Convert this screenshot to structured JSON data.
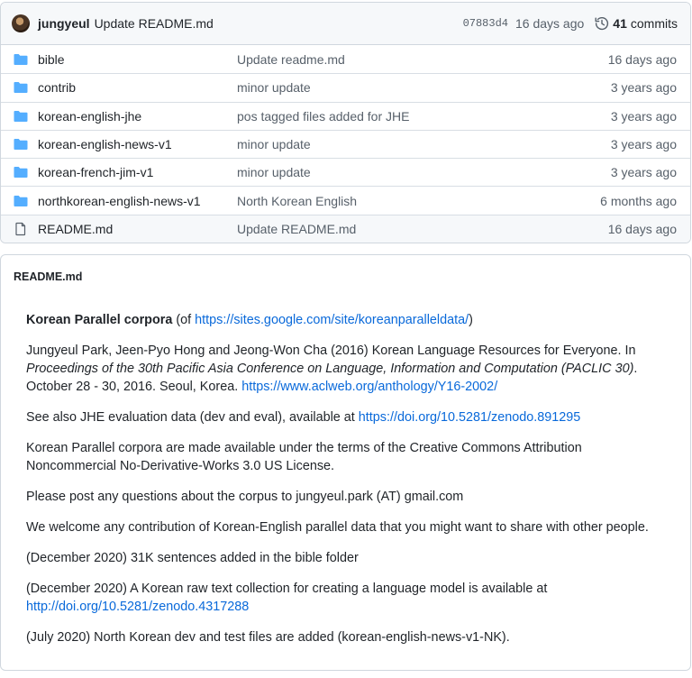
{
  "latest_commit": {
    "author": "jungyeul",
    "message": "Update README.md",
    "sha": "07883d4",
    "age": "16 days ago",
    "commits_count": "41",
    "commits_label": "commits"
  },
  "files": [
    {
      "name": "bible",
      "type": "folder",
      "commit": "Update readme.md",
      "age": "16 days ago"
    },
    {
      "name": "contrib",
      "type": "folder",
      "commit": "minor update",
      "age": "3 years ago"
    },
    {
      "name": "korean-english-jhe",
      "type": "folder",
      "commit": "pos tagged files added for JHE",
      "age": "3 years ago"
    },
    {
      "name": "korean-english-news-v1",
      "type": "folder",
      "commit": "minor update",
      "age": "3 years ago"
    },
    {
      "name": "korean-french-jim-v1",
      "type": "folder",
      "commit": "minor update",
      "age": "3 years ago"
    },
    {
      "name": "northkorean-english-news-v1",
      "type": "folder",
      "commit": "North Korean English",
      "age": "6 months ago"
    },
    {
      "name": "README.md",
      "type": "file",
      "commit": "Update README.md",
      "age": "16 days ago"
    }
  ],
  "readme": {
    "title": "README.md",
    "p1_bold": "Korean Parallel corpora",
    "p1_pre": " (of ",
    "p1_link": "https://sites.google.com/site/koreanparalleldata/",
    "p1_post": ")",
    "p2_text": "Jungyeul Park, Jeen-Pyo Hong and Jeong-Won Cha (2016) Korean Language Resources for Everyone. In ",
    "p2_em": "Proceedings of the 30th Pacific Asia Conference on Language, Information and Computation (PACLIC 30)",
    "p2_text2": ". October 28 - 30, 2016. Seoul, Korea. ",
    "p2_link": "https://www.aclweb.org/anthology/Y16-2002/",
    "p3_text": "See also JHE evaluation data (dev and eval), available at ",
    "p3_link": "https://doi.org/10.5281/zenodo.891295",
    "p4_text": "Korean Parallel corpora are made available under the terms of the Creative Commons Attribution Noncommercial No-Derivative-Works 3.0 US License.",
    "p5_text": "Please post any questions about the corpus to jungyeul.park (AT) gmail.com",
    "p6_text": "We welcome any contribution of Korean-English parallel data that you might want to share with other people.",
    "p7_text": "(December 2020) 31K sentences added in the bible folder",
    "p8_text": "(December 2020) A Korean raw text collection for creating a language model is available at ",
    "p8_link": "http://doi.org/10.5281/zenodo.4317288",
    "p9_text": "(July 2020) North Korean dev and test files are added (korean-english-news-v1-NK)."
  },
  "colors": {
    "folder": "#54aeff",
    "link": "#0969da",
    "muted": "#57606a"
  }
}
